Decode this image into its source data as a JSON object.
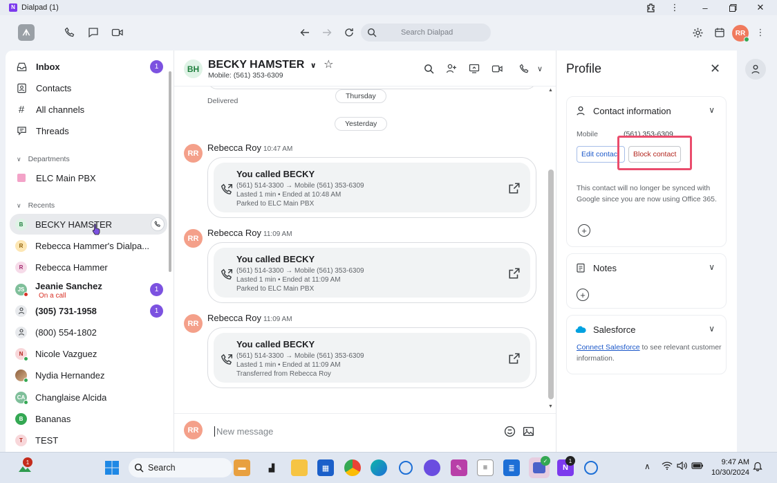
{
  "window": {
    "title": "Dialpad (1)"
  },
  "topbar": {
    "search_placeholder": "Search Dialpad",
    "avatar": "RR",
    "logo": "ᗑ"
  },
  "sidebar": {
    "nav": [
      {
        "label": "Inbox",
        "badge": "1"
      },
      {
        "label": "Contacts"
      },
      {
        "label": "All channels"
      },
      {
        "label": "Threads"
      }
    ],
    "departments_label": "Departments",
    "departments": [
      {
        "label": "ELC Main PBX"
      }
    ],
    "recents_label": "Recents",
    "recents": [
      {
        "label": "BECKY HAMSTER",
        "initial": "B",
        "bg": "#dff3e6",
        "fg": "#1e7f3d"
      },
      {
        "label": "Rebecca Hammer's Dialpa...",
        "initial": "R",
        "bg": "#fde7b4",
        "fg": "#8a5a00"
      },
      {
        "label": "Rebecca Hammer",
        "initial": "R",
        "bg": "#f6dbe9",
        "fg": "#a0266b"
      },
      {
        "label": "Jeanie Sanchez",
        "sub": "On a call",
        "initial": "JS",
        "bg": "#7fbf9a",
        "fg": "#fff",
        "badge": "1"
      },
      {
        "label": "(305) 731-1958",
        "initial": "person",
        "badge": "1"
      },
      {
        "label": "(800) 554-1802",
        "initial": "person"
      },
      {
        "label": "Nicole Vazguez",
        "initial": "N",
        "bg": "#f8d7da",
        "fg": "#b3261e"
      },
      {
        "label": "Nydia Hernandez",
        "initial": "photo"
      },
      {
        "label": "Changlaise Alcida",
        "initial": "CA",
        "bg": "#7fbf9a",
        "fg": "#fff"
      },
      {
        "label": "Bananas",
        "initial": "B",
        "bg": "#34a853",
        "fg": "#fff"
      },
      {
        "label": "TEST",
        "initial": "T",
        "bg": "#f8d7da",
        "fg": "#b3261e"
      }
    ]
  },
  "conversation": {
    "contact_initials": "BH",
    "contact_name": "BECKY HAMSTER",
    "contact_sub": "Mobile: (561) 353-6309",
    "delivered": "Delivered",
    "day_pills": [
      "Thursday",
      "Yesterday"
    ],
    "messages": [
      {
        "initials": "RR",
        "sender": "Rebecca Roy",
        "time": "10:47 AM",
        "title": "You called BECKY",
        "line1": "(561) 514-3300 → Mobile (561) 353-6309",
        "line2": "Lasted 1 min • Ended at 10:48 AM",
        "line3": "Parked to ELC Main PBX"
      },
      {
        "initials": "RR",
        "sender": "Rebecca Roy",
        "time": "11:09 AM",
        "title": "You called BECKY",
        "line1": "(561) 514-3300 → Mobile (561) 353-6309",
        "line2": "Lasted 1 min • Ended at 11:09 AM",
        "line3": "Parked to ELC Main PBX"
      },
      {
        "initials": "RR",
        "sender": "Rebecca Roy",
        "time": "11:09 AM",
        "title": "You called BECKY",
        "line1": "(561) 514-3300 → Mobile (561) 353-6309",
        "line2": "Lasted 1 min • Ended at 11:09 AM",
        "line3": "Transferred from Rebecca Roy"
      }
    ],
    "compose_avatar": "RR",
    "compose_placeholder": "New message"
  },
  "profile": {
    "title": "Profile",
    "contact_info_label": "Contact information",
    "mobile_label": "Mobile",
    "mobile_value": "(561) 353-6309",
    "edit_button": "Edit contact",
    "block_button": "Block contact",
    "sync_note": "This contact will no longer be synced with Google since you are now using Office 365.",
    "notes_label": "Notes",
    "salesforce_label": "Salesforce",
    "salesforce_link": "Connect Salesforce",
    "salesforce_text": " to see relevant customer information."
  },
  "taskbar": {
    "search_label": "Search",
    "time": "9:47 AM",
    "date": "10/30/2024",
    "badge_a": "1",
    "badge_b": "1"
  },
  "colors": {
    "accent": "#7c52e0",
    "highlight": "#ea4c6c",
    "link": "#1a57c9"
  }
}
